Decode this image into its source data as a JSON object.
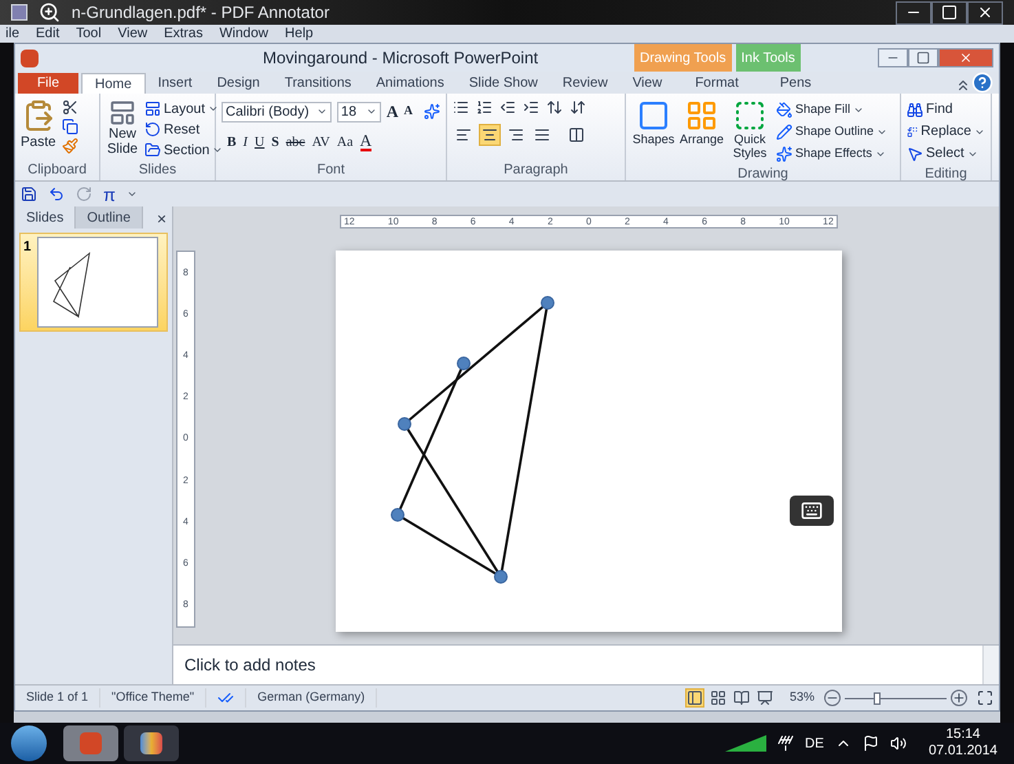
{
  "outer_window": {
    "title": "n-Grundlagen.pdf* - PDF Annotator",
    "menu": [
      "ile",
      "Edit",
      "Tool",
      "View",
      "Extras",
      "Window",
      "Help"
    ]
  },
  "window": {
    "title": "Movingaround  -  Microsoft PowerPoint",
    "context_tabs": [
      {
        "label": "Drawing Tools",
        "color": "#f0a050"
      },
      {
        "label": "Ink Tools",
        "color": "#6cc070"
      }
    ]
  },
  "tabs": [
    {
      "label": "File",
      "kind": "file",
      "selected": false
    },
    {
      "label": "Home",
      "kind": "tab",
      "selected": true
    },
    {
      "label": "Insert",
      "kind": "tab",
      "selected": false
    },
    {
      "label": "Design",
      "kind": "tab",
      "selected": false
    },
    {
      "label": "Transitions",
      "kind": "tab",
      "selected": false
    },
    {
      "label": "Animations",
      "kind": "tab",
      "selected": false
    },
    {
      "label": "Slide Show",
      "kind": "tab",
      "selected": false
    },
    {
      "label": "Review",
      "kind": "tab",
      "selected": false
    },
    {
      "label": "View",
      "kind": "tab",
      "selected": false
    },
    {
      "label": "Format",
      "kind": "context",
      "selected": false
    },
    {
      "label": "Pens",
      "kind": "context",
      "selected": false
    }
  ],
  "ribbon": {
    "clipboard": {
      "label": "Clipboard",
      "paste": "Paste"
    },
    "slides": {
      "label": "Slides",
      "new_slide": [
        "New",
        "Slide"
      ],
      "items": [
        "Layout",
        "Reset",
        "Section"
      ]
    },
    "font": {
      "label": "Font",
      "font_name": "Calibri (Body)",
      "font_size": "18",
      "grow": "A",
      "shrink": "A",
      "buttons": [
        "B",
        "I",
        "U",
        "S",
        "abc",
        "AV",
        "Aa",
        "A"
      ]
    },
    "paragraph": {
      "label": "Paragraph",
      "aligns": [
        {
          "selected": false
        },
        {
          "selected": true
        },
        {
          "selected": false
        },
        {
          "selected": false
        }
      ]
    },
    "drawing": {
      "label": "Drawing",
      "big": [
        "Shapes",
        "Arrange",
        "Quick Styles"
      ],
      "items": [
        "Shape Fill",
        "Shape Outline",
        "Shape Effects"
      ]
    },
    "editing": {
      "label": "Editing",
      "items": [
        "Find",
        "Replace",
        "Select"
      ]
    }
  },
  "quick_access": {
    "pi": "π"
  },
  "pane": {
    "tabs": [
      {
        "label": "Slides",
        "selected": true
      },
      {
        "label": "Outline",
        "selected": false
      }
    ],
    "close": "×",
    "thumbnails": [
      {
        "number": "1",
        "selected": true
      }
    ]
  },
  "rulers": {
    "horizontal": [
      "12",
      "10",
      "8",
      "6",
      "4",
      "2",
      "0",
      "2",
      "4",
      "6",
      "8",
      "10",
      "12"
    ],
    "vertical": [
      "8",
      "6",
      "4",
      "2",
      "0",
      "2",
      "4",
      "6",
      "8"
    ]
  },
  "notes": {
    "placeholder": "Click to add notes"
  },
  "status_bar": {
    "slide": "Slide 1 of 1",
    "theme": "\"Office Theme\"",
    "language": "German (Germany)",
    "views": [
      {
        "selected": true
      },
      {
        "selected": false
      },
      {
        "selected": false
      },
      {
        "selected": false
      }
    ],
    "zoom": "53%",
    "level": 0.3
  },
  "taskbar": {
    "apps": [
      {
        "selected": true
      },
      {
        "selected": false
      }
    ],
    "tray": {
      "language": "DE",
      "time": "15:14",
      "date": "07.01.2014"
    }
  }
}
